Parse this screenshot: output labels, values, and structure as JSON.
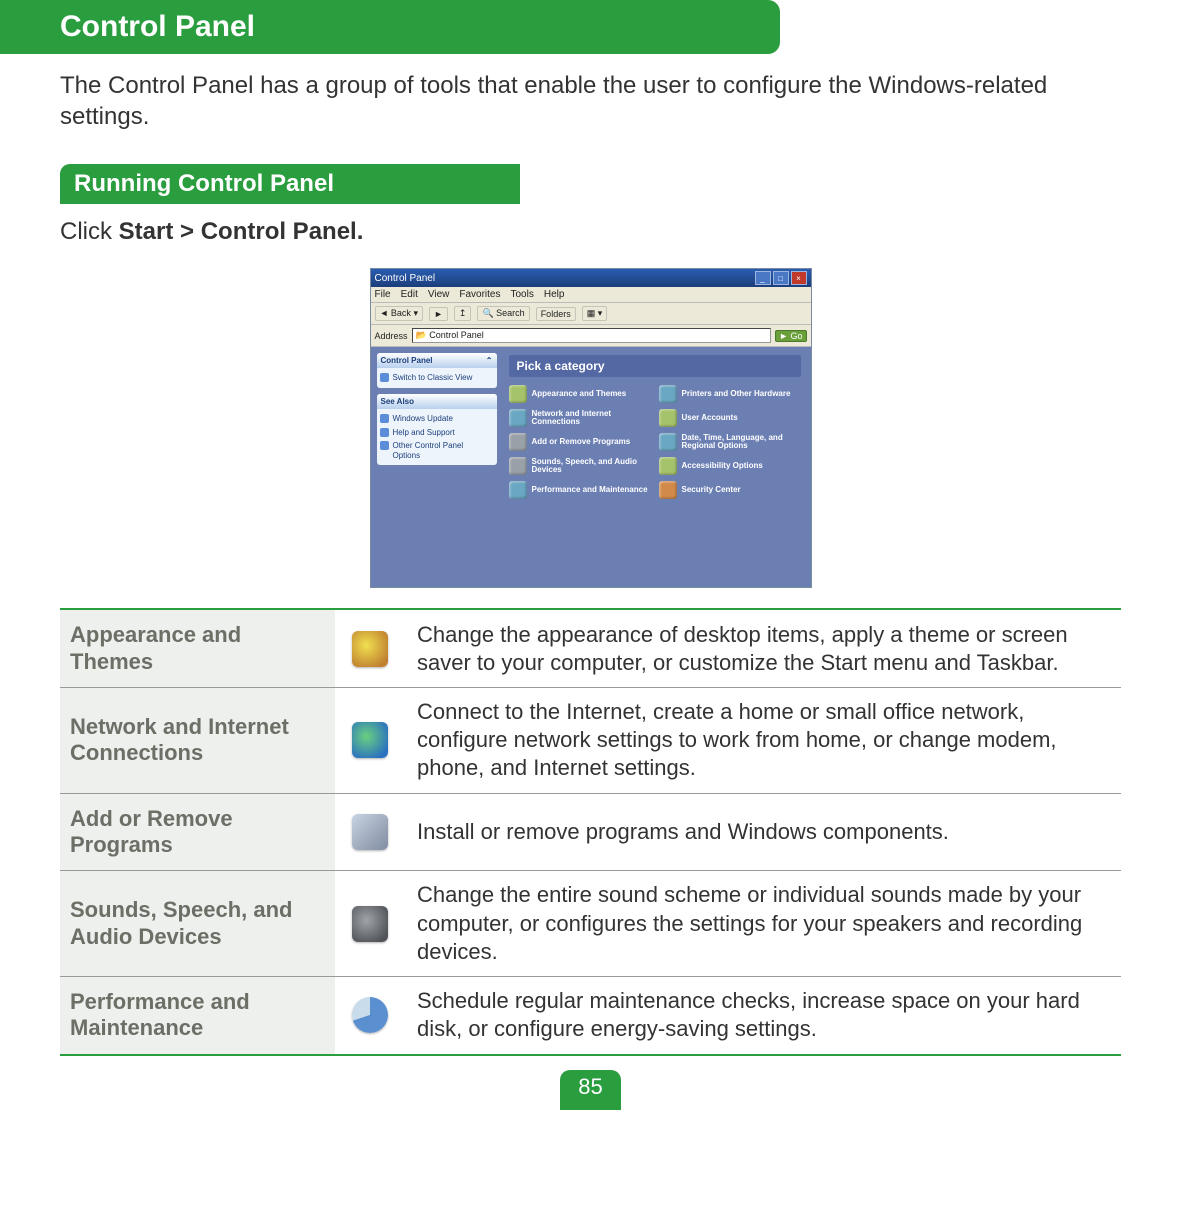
{
  "section_title": "Control Panel",
  "intro": "The Control Panel has a group of tools that enable the user to configure the Windows-related settings.",
  "subsection_title": "Running Control Panel",
  "click_prefix": "Click ",
  "click_bold": "Start > Control Panel.",
  "screenshot": {
    "title": "Control Panel",
    "menu": [
      "File",
      "Edit",
      "View",
      "Favorites",
      "Tools",
      "Help"
    ],
    "toolbar": {
      "back": "Back",
      "search": "Search",
      "folders": "Folders"
    },
    "address_label": "Address",
    "address_value": "Control Panel",
    "go": "Go",
    "side_box1_title": "Control Panel",
    "side_box1_item": "Switch to Classic View",
    "side_box2_title": "See Also",
    "side_box2_items": [
      "Windows Update",
      "Help and Support",
      "Other Control Panel Options"
    ],
    "pick_header": "Pick a category",
    "categories_left": [
      "Appearance and Themes",
      "Network and Internet Connections",
      "Add or Remove Programs",
      "Sounds, Speech, and Audio Devices",
      "Performance and Maintenance"
    ],
    "categories_right": [
      "Printers and Other Hardware",
      "User Accounts",
      "Date, Time, Language, and Regional Options",
      "Accessibility Options",
      "Security Center"
    ]
  },
  "table": [
    {
      "title": "Appearance and Themes",
      "desc": "Change the appearance of desktop items, apply a theme or screen saver to your computer, or customize the Start menu and Taskbar."
    },
    {
      "title": "Network and Internet Connections",
      "desc": "Connect to the Internet, create a home or small office network, configure network settings to work from home, or change modem, phone, and Internet settings."
    },
    {
      "title": "Add or Remove Programs",
      "desc": "Install or remove programs and Windows components."
    },
    {
      "title": "Sounds, Speech, and Audio Devices",
      "desc": "Change the entire sound scheme or individual sounds made by your computer, or configures the settings for your speakers and recording devices."
    },
    {
      "title": "Performance and Maintenance",
      "desc": "Schedule regular maintenance checks, increase space on your hard disk, or configure energy-saving settings."
    }
  ],
  "page_number": "85"
}
